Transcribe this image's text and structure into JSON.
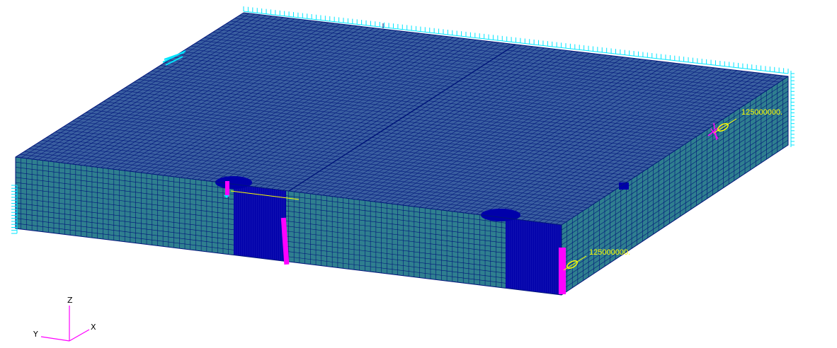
{
  "colors": {
    "background": "#ffffff",
    "top_face": "#3a5fa0",
    "side_face": "#2f7f8f",
    "mesh_line": "#00157a",
    "dense_mesh": "#0000aa",
    "constraint": "#00e5ff",
    "load_marker": "#ff00ff",
    "load_label": "#ffff00",
    "triad": "#ff00ff"
  },
  "loads": [
    {
      "label": "125000000."
    },
    {
      "label": "125000000."
    }
  ],
  "triad": {
    "x_label": "X",
    "y_label": "Y",
    "z_label": "Z"
  }
}
